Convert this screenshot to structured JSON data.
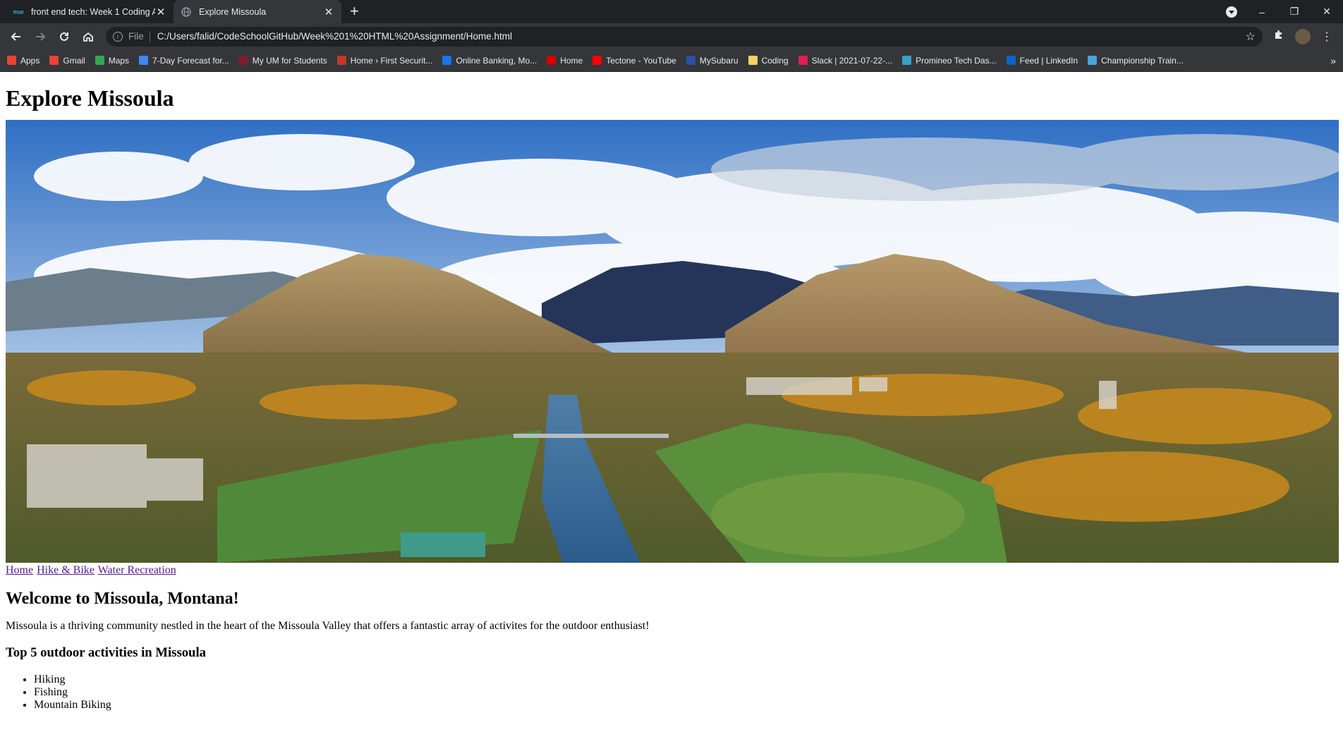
{
  "browser": {
    "tabs": [
      {
        "title": "front end tech: Week 1 Coding A",
        "favicon": "promineo-icon",
        "active": false
      },
      {
        "title": "Explore Missoula",
        "favicon": "globe-icon",
        "active": true
      }
    ],
    "address": {
      "scheme": "File",
      "url": "C:/Users/falid/CodeSchoolGitHub/Week%201%20HTML%20Assignment/Home.html"
    },
    "bookmarks": [
      {
        "label": "Apps",
        "icon": "apps-grid-icon",
        "color": "#ea4335"
      },
      {
        "label": "Gmail",
        "icon": "gmail-icon",
        "color": "#ea4335"
      },
      {
        "label": "Maps",
        "icon": "maps-pin-icon",
        "color": "#34a853"
      },
      {
        "label": "7-Day Forecast for...",
        "icon": "weather-icon",
        "color": "#4285f4"
      },
      {
        "label": "My UM for Students",
        "icon": "um-icon",
        "color": "#7a1f2b"
      },
      {
        "label": "Home › First Securit...",
        "icon": "bank-icon",
        "color": "#c0392b"
      },
      {
        "label": "Online Banking, Mo...",
        "icon": "citi-icon",
        "color": "#1a73e8"
      },
      {
        "label": "Home",
        "icon": "flag-icon",
        "color": "#d50000"
      },
      {
        "label": "Tectone - YouTube",
        "icon": "youtube-icon",
        "color": "#ff0000"
      },
      {
        "label": "MySubaru",
        "icon": "subaru-icon",
        "color": "#2b4fa3"
      },
      {
        "label": "Coding",
        "icon": "folder-icon",
        "color": "#f6d365"
      },
      {
        "label": "Slack | 2021-07-22-...",
        "icon": "slack-icon",
        "color": "#e01e5a"
      },
      {
        "label": "Promineo Tech Das...",
        "icon": "promineo-icon",
        "color": "#3aa0c8"
      },
      {
        "label": "Feed | LinkedIn",
        "icon": "linkedin-icon",
        "color": "#0a66c2"
      },
      {
        "label": "Championship Train...",
        "icon": "training-icon",
        "color": "#4aa3df"
      }
    ]
  },
  "page": {
    "heading": "Explore Missoula",
    "hero_alt": "Aerial view of Missoula",
    "nav": [
      "Home",
      "Hike & Bike",
      "Water Recreation"
    ],
    "welcome": "Welcome to Missoula, Montana!",
    "intro": "Missoula is a thriving community nestled in the heart of the Missoula Valley that offers a fantastic array of activites for the outdoor enthusiast!",
    "top_heading": "Top 5 outdoor activities in Missoula",
    "activities": [
      "Hiking",
      "Fishing",
      "Mountain Biking"
    ]
  }
}
